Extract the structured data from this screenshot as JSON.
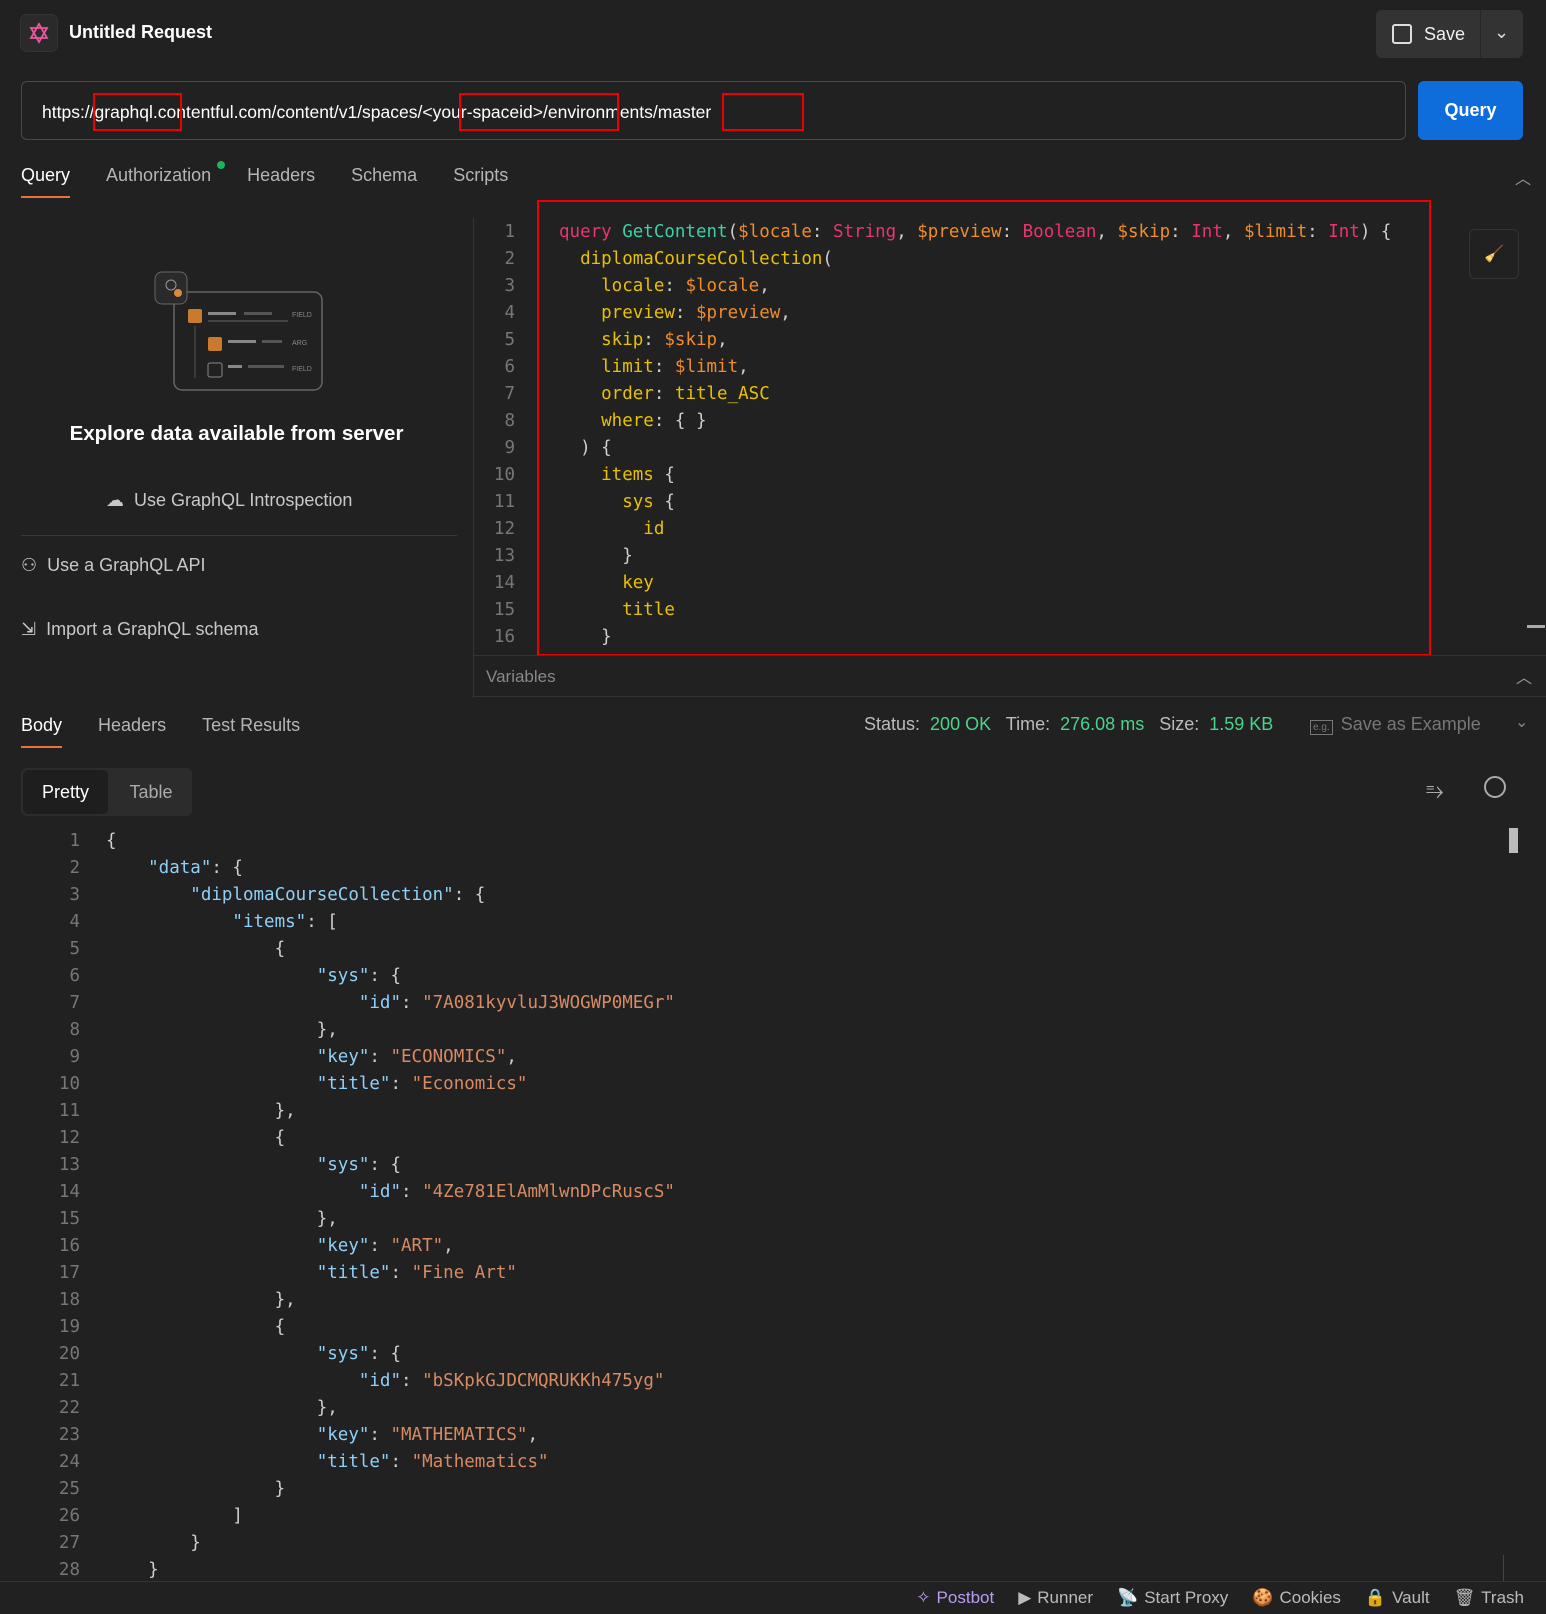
{
  "header": {
    "title": "Untitled Request",
    "save_label": "Save"
  },
  "url": {
    "value": "https://graphql.contentful.com/content/v1/spaces/<your-spaceid>/environments/master",
    "send_label": "Query"
  },
  "request_tabs": [
    "Query",
    "Authorization",
    "Headers",
    "Schema",
    "Scripts"
  ],
  "explorer": {
    "heading": "Explore data available from server",
    "introspection": "Use GraphQL Introspection",
    "use_api": "Use a GraphQL API",
    "import_schema": "Import a GraphQL schema",
    "illus_labels": [
      "FIELD",
      "ARG",
      "FIELD"
    ]
  },
  "variables_label": "Variables",
  "query_lines": [
    [
      [
        "kw",
        "query "
      ],
      [
        "fn",
        "GetContent"
      ],
      [
        "p",
        "("
      ],
      [
        "var",
        "$locale"
      ],
      [
        "p",
        ": "
      ],
      [
        "ty",
        "String"
      ],
      [
        "p",
        ", "
      ],
      [
        "var",
        "$preview"
      ],
      [
        "p",
        ": "
      ],
      [
        "ty",
        "Boolean"
      ],
      [
        "p",
        ", "
      ],
      [
        "var",
        "$skip"
      ],
      [
        "p",
        ": "
      ],
      [
        "ty",
        "Int"
      ],
      [
        "p",
        ", "
      ],
      [
        "var",
        "$limit"
      ],
      [
        "p",
        ": "
      ],
      [
        "ty",
        "Int"
      ],
      [
        "p",
        ") {"
      ]
    ],
    [
      [
        "fld",
        "  diplomaCourseCollection"
      ],
      [
        "p",
        "("
      ]
    ],
    [
      [
        "fld",
        "    locale"
      ],
      [
        "p",
        ": "
      ],
      [
        "var",
        "$locale"
      ],
      [
        "p",
        ","
      ]
    ],
    [
      [
        "fld",
        "    preview"
      ],
      [
        "p",
        ": "
      ],
      [
        "var",
        "$preview"
      ],
      [
        "p",
        ","
      ]
    ],
    [
      [
        "fld",
        "    skip"
      ],
      [
        "p",
        ": "
      ],
      [
        "var",
        "$skip"
      ],
      [
        "p",
        ","
      ]
    ],
    [
      [
        "fld",
        "    limit"
      ],
      [
        "p",
        ": "
      ],
      [
        "var",
        "$limit"
      ],
      [
        "p",
        ","
      ]
    ],
    [
      [
        "fld",
        "    order"
      ],
      [
        "p",
        ": "
      ],
      [
        "fld",
        "title_ASC"
      ]
    ],
    [
      [
        "fld",
        "    where"
      ],
      [
        "p",
        ": { }"
      ]
    ],
    [
      [
        "p",
        "  ) {"
      ]
    ],
    [
      [
        "fld",
        "    items"
      ],
      [
        "p",
        " {"
      ]
    ],
    [
      [
        "fld",
        "      sys"
      ],
      [
        "p",
        " {"
      ]
    ],
    [
      [
        "fld",
        "        id"
      ]
    ],
    [
      [
        "p",
        "      }"
      ]
    ],
    [
      [
        "fld",
        "      key"
      ]
    ],
    [
      [
        "fld",
        "      title"
      ]
    ],
    [
      [
        "p",
        "    }"
      ]
    ]
  ],
  "response_tabs": [
    "Body",
    "Headers",
    "Test Results"
  ],
  "status": {
    "status_label": "Status:",
    "status": "200 OK",
    "time_label": "Time:",
    "time": "276.08 ms",
    "size_label": "Size:",
    "size": "1.59 KB",
    "save_example": "Save as Example"
  },
  "view_toggle": [
    "Pretty",
    "Table"
  ],
  "json_lines": [
    [
      [
        "p",
        "{"
      ]
    ],
    [
      [
        "jk",
        "    \"data\""
      ],
      [
        "p",
        ": {"
      ]
    ],
    [
      [
        "jk",
        "        \"diplomaCourseCollection\""
      ],
      [
        "p",
        ": {"
      ]
    ],
    [
      [
        "jk",
        "            \"items\""
      ],
      [
        "p",
        ": ["
      ]
    ],
    [
      [
        "p",
        "                {"
      ]
    ],
    [
      [
        "jk",
        "                    \"sys\""
      ],
      [
        "p",
        ": {"
      ]
    ],
    [
      [
        "jk",
        "                        \"id\""
      ],
      [
        "p",
        ": "
      ],
      [
        "js",
        "\"7A081kyvluJ3WOGWP0MEGr\""
      ]
    ],
    [
      [
        "p",
        "                    },"
      ]
    ],
    [
      [
        "jk",
        "                    \"key\""
      ],
      [
        "p",
        ": "
      ],
      [
        "js",
        "\"ECONOMICS\""
      ],
      [
        "p",
        ","
      ]
    ],
    [
      [
        "jk",
        "                    \"title\""
      ],
      [
        "p",
        ": "
      ],
      [
        "js",
        "\"Economics\""
      ]
    ],
    [
      [
        "p",
        "                },"
      ]
    ],
    [
      [
        "p",
        "                {"
      ]
    ],
    [
      [
        "jk",
        "                    \"sys\""
      ],
      [
        "p",
        ": {"
      ]
    ],
    [
      [
        "jk",
        "                        \"id\""
      ],
      [
        "p",
        ": "
      ],
      [
        "js",
        "\"4Ze781ElAmMlwnDPcRuscS\""
      ]
    ],
    [
      [
        "p",
        "                    },"
      ]
    ],
    [
      [
        "jk",
        "                    \"key\""
      ],
      [
        "p",
        ": "
      ],
      [
        "js",
        "\"ART\""
      ],
      [
        "p",
        ","
      ]
    ],
    [
      [
        "jk",
        "                    \"title\""
      ],
      [
        "p",
        ": "
      ],
      [
        "js",
        "\"Fine Art\""
      ]
    ],
    [
      [
        "p",
        "                },"
      ]
    ],
    [
      [
        "p",
        "                {"
      ]
    ],
    [
      [
        "jk",
        "                    \"sys\""
      ],
      [
        "p",
        ": {"
      ]
    ],
    [
      [
        "jk",
        "                        \"id\""
      ],
      [
        "p",
        ": "
      ],
      [
        "js",
        "\"bSKpkGJDCMQRUKKh475yg\""
      ]
    ],
    [
      [
        "p",
        "                    },"
      ]
    ],
    [
      [
        "jk",
        "                    \"key\""
      ],
      [
        "p",
        ": "
      ],
      [
        "js",
        "\"MATHEMATICS\""
      ],
      [
        "p",
        ","
      ]
    ],
    [
      [
        "jk",
        "                    \"title\""
      ],
      [
        "p",
        ": "
      ],
      [
        "js",
        "\"Mathematics\""
      ]
    ],
    [
      [
        "p",
        "                }"
      ]
    ],
    [
      [
        "p",
        "            ]"
      ]
    ],
    [
      [
        "p",
        "        }"
      ]
    ],
    [
      [
        "p",
        "    }"
      ]
    ]
  ],
  "footer": [
    "Postbot",
    "Runner",
    "Start Proxy",
    "Cookies",
    "Vault",
    "Trash"
  ],
  "colors": {
    "accent": "#0f6ddb",
    "highlight": "#e00000",
    "tab_underline": "#e8743b",
    "success": "#4cd38a"
  }
}
